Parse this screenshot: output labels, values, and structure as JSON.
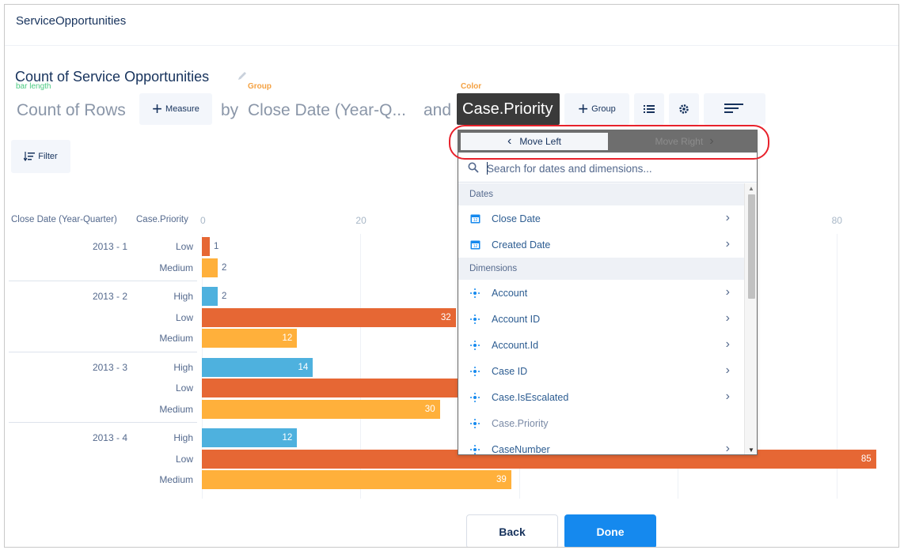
{
  "app": {
    "title": "ServiceOpportunities"
  },
  "chart_header": {
    "title": "Count of Service Opportunities",
    "bar_length_label": "bar length",
    "group_label": "Group",
    "color_label": "Color"
  },
  "query": {
    "measure": "Count of Rows",
    "add_measure": "Measure",
    "by": "by",
    "group_value": "Close Date (Year-Q...",
    "and": "and",
    "color_value": "Case.Priority",
    "add_group": "Group"
  },
  "filter": {
    "label": "Filter"
  },
  "table": {
    "col1": "Close Date (Year-Quarter)",
    "col2": "Case.Priority",
    "groups": [
      "2013 - 1",
      "2013 - 2",
      "2013 - 3",
      "2013 - 4"
    ],
    "rows": [
      {
        "priority": "Low",
        "value": 1
      },
      {
        "priority": "Medium",
        "value": 2
      },
      {
        "priority": "High",
        "value": 2
      },
      {
        "priority": "Low",
        "value": 32
      },
      {
        "priority": "Medium",
        "value": 12
      },
      {
        "priority": "High",
        "value": 14
      },
      {
        "priority": "Low",
        "value": null
      },
      {
        "priority": "Medium",
        "value": 30
      },
      {
        "priority": "High",
        "value": 12
      },
      {
        "priority": "Low",
        "value": 85
      },
      {
        "priority": "Medium",
        "value": 39
      }
    ]
  },
  "chart_data": {
    "type": "bar",
    "orientation": "horizontal",
    "x_ticks": [
      "0",
      "20",
      "80"
    ],
    "xlim": [
      0,
      85
    ],
    "series_colors": {
      "High": "#4eb1de",
      "Low": "#e66734",
      "Medium": "#ffb03b"
    },
    "categories": [
      "2013 - 1 Low",
      "2013 - 1 Medium",
      "2013 - 2 High",
      "2013 - 2 Low",
      "2013 - 2 Medium",
      "2013 - 3 High",
      "2013 - 3 Low",
      "2013 - 3 Medium",
      "2013 - 4 High",
      "2013 - 4 Low",
      "2013 - 4 Medium"
    ],
    "values": [
      1,
      2,
      2,
      32,
      12,
      14,
      null,
      30,
      12,
      85,
      39
    ]
  },
  "dropdown": {
    "move_left": "Move Left",
    "move_right": "Move Right",
    "search_placeholder": "Search for dates and dimensions...",
    "sections": [
      {
        "title": "Dates",
        "items": [
          "Close Date",
          "Created Date"
        ]
      },
      {
        "title": "Dimensions",
        "items": [
          "Account",
          "Account ID",
          "Account.Id",
          "Case ID",
          "Case.IsEscalated",
          "Case.Priority",
          "CaseNumber"
        ]
      }
    ]
  },
  "footer": {
    "back": "Back",
    "done": "Done"
  },
  "colors": {
    "accent": "#1589ee",
    "highlight": "#e8212b",
    "pill": "#3a3a3a"
  }
}
